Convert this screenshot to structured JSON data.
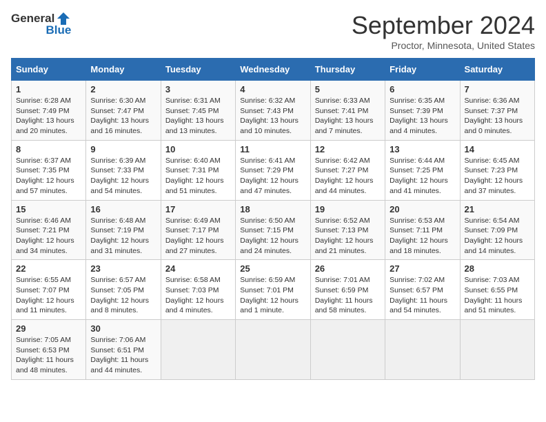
{
  "logo": {
    "general": "General",
    "blue": "Blue"
  },
  "header": {
    "month": "September 2024",
    "location": "Proctor, Minnesota, United States"
  },
  "weekdays": [
    "Sunday",
    "Monday",
    "Tuesday",
    "Wednesday",
    "Thursday",
    "Friday",
    "Saturday"
  ],
  "weeks": [
    [
      {
        "day": "1",
        "sunrise": "6:28 AM",
        "sunset": "7:49 PM",
        "daylight": "13 hours and 20 minutes."
      },
      {
        "day": "2",
        "sunrise": "6:30 AM",
        "sunset": "7:47 PM",
        "daylight": "13 hours and 16 minutes."
      },
      {
        "day": "3",
        "sunrise": "6:31 AM",
        "sunset": "7:45 PM",
        "daylight": "13 hours and 13 minutes."
      },
      {
        "day": "4",
        "sunrise": "6:32 AM",
        "sunset": "7:43 PM",
        "daylight": "13 hours and 10 minutes."
      },
      {
        "day": "5",
        "sunrise": "6:33 AM",
        "sunset": "7:41 PM",
        "daylight": "13 hours and 7 minutes."
      },
      {
        "day": "6",
        "sunrise": "6:35 AM",
        "sunset": "7:39 PM",
        "daylight": "13 hours and 4 minutes."
      },
      {
        "day": "7",
        "sunrise": "6:36 AM",
        "sunset": "7:37 PM",
        "daylight": "13 hours and 0 minutes."
      }
    ],
    [
      {
        "day": "8",
        "sunrise": "6:37 AM",
        "sunset": "7:35 PM",
        "daylight": "12 hours and 57 minutes."
      },
      {
        "day": "9",
        "sunrise": "6:39 AM",
        "sunset": "7:33 PM",
        "daylight": "12 hours and 54 minutes."
      },
      {
        "day": "10",
        "sunrise": "6:40 AM",
        "sunset": "7:31 PM",
        "daylight": "12 hours and 51 minutes."
      },
      {
        "day": "11",
        "sunrise": "6:41 AM",
        "sunset": "7:29 PM",
        "daylight": "12 hours and 47 minutes."
      },
      {
        "day": "12",
        "sunrise": "6:42 AM",
        "sunset": "7:27 PM",
        "daylight": "12 hours and 44 minutes."
      },
      {
        "day": "13",
        "sunrise": "6:44 AM",
        "sunset": "7:25 PM",
        "daylight": "12 hours and 41 minutes."
      },
      {
        "day": "14",
        "sunrise": "6:45 AM",
        "sunset": "7:23 PM",
        "daylight": "12 hours and 37 minutes."
      }
    ],
    [
      {
        "day": "15",
        "sunrise": "6:46 AM",
        "sunset": "7:21 PM",
        "daylight": "12 hours and 34 minutes."
      },
      {
        "day": "16",
        "sunrise": "6:48 AM",
        "sunset": "7:19 PM",
        "daylight": "12 hours and 31 minutes."
      },
      {
        "day": "17",
        "sunrise": "6:49 AM",
        "sunset": "7:17 PM",
        "daylight": "12 hours and 27 minutes."
      },
      {
        "day": "18",
        "sunrise": "6:50 AM",
        "sunset": "7:15 PM",
        "daylight": "12 hours and 24 minutes."
      },
      {
        "day": "19",
        "sunrise": "6:52 AM",
        "sunset": "7:13 PM",
        "daylight": "12 hours and 21 minutes."
      },
      {
        "day": "20",
        "sunrise": "6:53 AM",
        "sunset": "7:11 PM",
        "daylight": "12 hours and 18 minutes."
      },
      {
        "day": "21",
        "sunrise": "6:54 AM",
        "sunset": "7:09 PM",
        "daylight": "12 hours and 14 minutes."
      }
    ],
    [
      {
        "day": "22",
        "sunrise": "6:55 AM",
        "sunset": "7:07 PM",
        "daylight": "12 hours and 11 minutes."
      },
      {
        "day": "23",
        "sunrise": "6:57 AM",
        "sunset": "7:05 PM",
        "daylight": "12 hours and 8 minutes."
      },
      {
        "day": "24",
        "sunrise": "6:58 AM",
        "sunset": "7:03 PM",
        "daylight": "12 hours and 4 minutes."
      },
      {
        "day": "25",
        "sunrise": "6:59 AM",
        "sunset": "7:01 PM",
        "daylight": "12 hours and 1 minute."
      },
      {
        "day": "26",
        "sunrise": "7:01 AM",
        "sunset": "6:59 PM",
        "daylight": "11 hours and 58 minutes."
      },
      {
        "day": "27",
        "sunrise": "7:02 AM",
        "sunset": "6:57 PM",
        "daylight": "11 hours and 54 minutes."
      },
      {
        "day": "28",
        "sunrise": "7:03 AM",
        "sunset": "6:55 PM",
        "daylight": "11 hours and 51 minutes."
      }
    ],
    [
      {
        "day": "29",
        "sunrise": "7:05 AM",
        "sunset": "6:53 PM",
        "daylight": "11 hours and 48 minutes."
      },
      {
        "day": "30",
        "sunrise": "7:06 AM",
        "sunset": "6:51 PM",
        "daylight": "11 hours and 44 minutes."
      },
      null,
      null,
      null,
      null,
      null
    ]
  ],
  "labels": {
    "sunrise": "Sunrise:",
    "sunset": "Sunset:",
    "daylight": "Daylight:"
  }
}
